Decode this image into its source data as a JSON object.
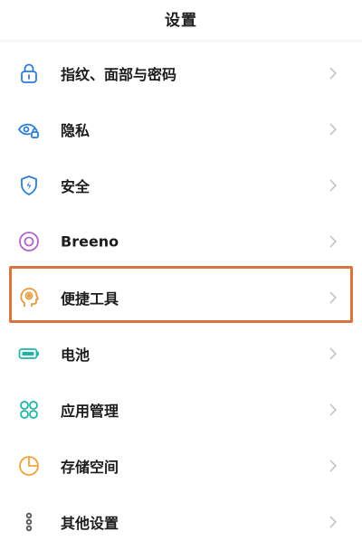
{
  "header": {
    "title": "设置"
  },
  "items": [
    {
      "label": "指纹、面部与密码",
      "icon": "lock-icon",
      "color": "#2f7fd0"
    },
    {
      "label": "隐私",
      "icon": "eye-lock-icon",
      "color": "#2f7fd0"
    },
    {
      "label": "安全",
      "icon": "shield-bolt-icon",
      "color": "#2f7fd0"
    },
    {
      "label": "Breeno",
      "icon": "breeno-circle-icon",
      "color": "#b166c8"
    },
    {
      "label": "便捷工具",
      "icon": "head-gear-icon",
      "color": "#e79a3b"
    },
    {
      "label": "电池",
      "icon": "battery-icon",
      "color": "#1fb5a5"
    },
    {
      "label": "应用管理",
      "icon": "apps-grid-icon",
      "color": "#1fb5a5"
    },
    {
      "label": "存储空间",
      "icon": "pie-chart-icon",
      "color": "#f2a33a"
    },
    {
      "label": "其他设置",
      "icon": "more-dots-icon",
      "color": "#555555"
    }
  ],
  "highlight": {
    "target": "便捷工具",
    "color": "#d9733f"
  },
  "chevron": {
    "icon": "chevron-right-icon",
    "color": "#c4c4c4"
  }
}
